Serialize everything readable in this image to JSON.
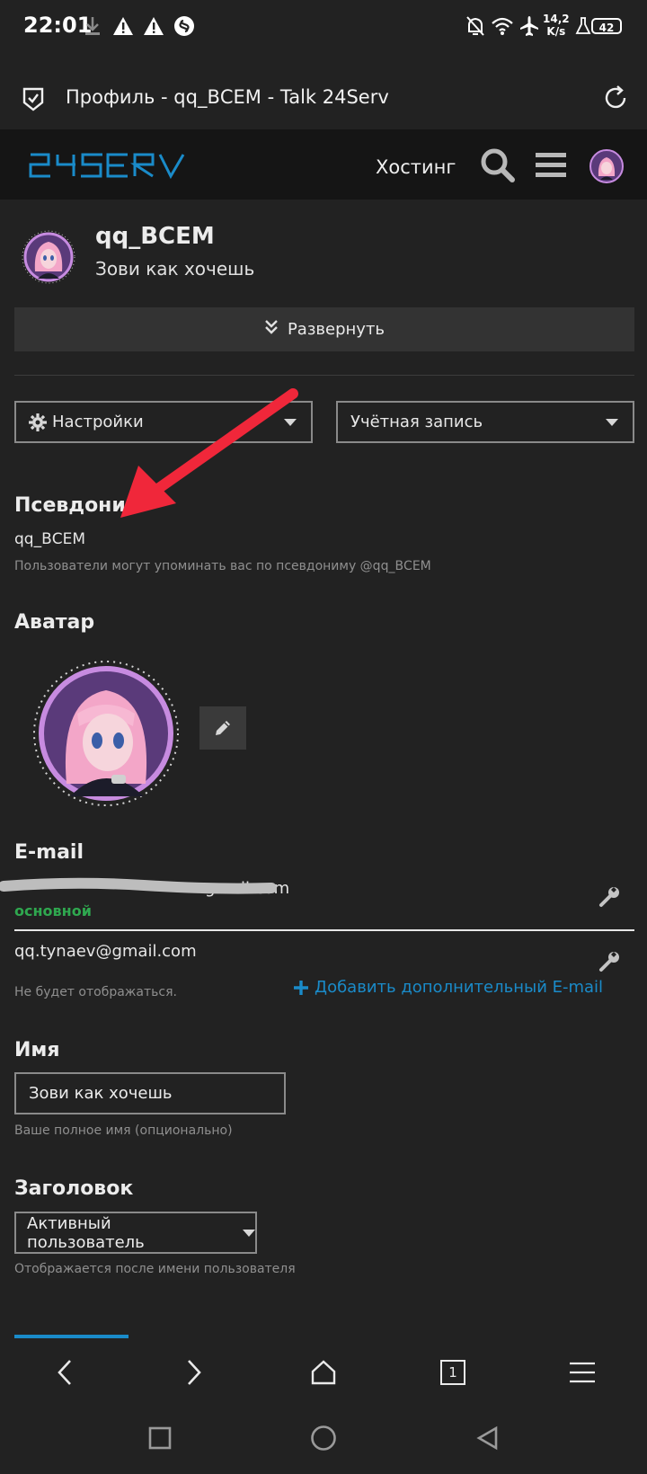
{
  "status_bar": {
    "time": "22:01",
    "speed_value": "14,2",
    "speed_unit": "K/s",
    "battery": "42"
  },
  "browser": {
    "page_title": "Профиль - qq_ВСЕМ - Talk 24Serv"
  },
  "site_header": {
    "logo_text": "24SERV",
    "hosting_label": "Хостинг"
  },
  "profile": {
    "username": "qq_ВСЕМ",
    "subtitle": "Зови как хочешь",
    "expand_label": "Развернуть",
    "settings_label": "Настройки",
    "account_label": "Учётная запись"
  },
  "pseudonym": {
    "title": "Псевдоним",
    "value": "qq_ВСЕМ",
    "hint": "Пользователи могут упоминать вас по псевдониму @qq_ВСЕМ"
  },
  "avatar": {
    "title": "Аватар"
  },
  "email": {
    "title": "E-mail",
    "primary_visible_part": "gmail.com",
    "primary_badge": "основной",
    "secondary_value": "qq.tynaev@gmail.com",
    "secondary_hint": "Не будет отображаться.",
    "add_label": "Добавить дополнительный E-mail"
  },
  "name": {
    "title": "Имя",
    "value": "Зови как хочешь",
    "hint": "Ваше полное имя (опционально)"
  },
  "heading": {
    "title": "Заголовок",
    "selected": "Активный пользователь",
    "hint": "Отображается после имени пользователя"
  },
  "browser_nav": {
    "tab_count": "1"
  },
  "colors": {
    "background": "#222222",
    "header_bg": "#151515",
    "accent_blue": "#1a8bc9",
    "primary_green": "#2fa84f",
    "annotation_red": "#f0273a"
  }
}
